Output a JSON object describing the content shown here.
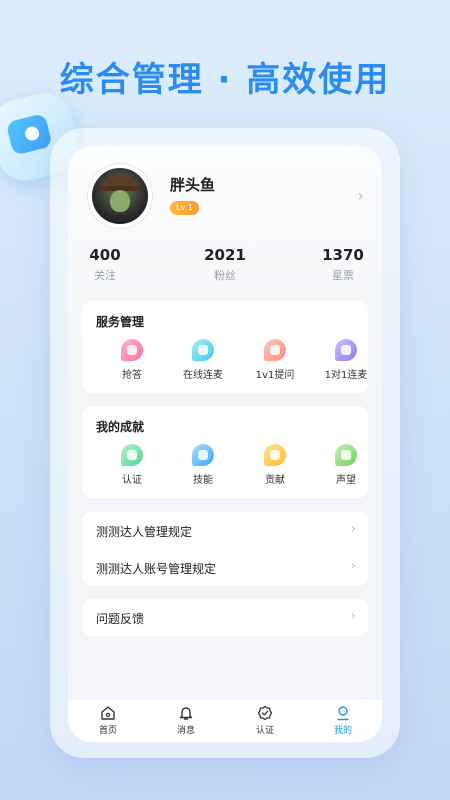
{
  "headline": "综合管理 · 高效使用",
  "profile": {
    "name": "胖头鱼",
    "level": "Lv 1",
    "arrow": "›"
  },
  "stats": [
    {
      "value": "400",
      "label": "关注"
    },
    {
      "value": "2021",
      "label": "粉丝"
    },
    {
      "value": "1370",
      "label": "星票"
    }
  ],
  "service": {
    "title": "服务管理",
    "items": [
      {
        "label": "抢答",
        "icon": "lightning-icon",
        "color": "#ff7aa8"
      },
      {
        "label": "在线连麦",
        "icon": "play-icon",
        "color": "#54d6e6"
      },
      {
        "label": "1v1提问",
        "icon": "chat-icon",
        "color": "#ff9a8a"
      },
      {
        "label": "1对1连麦",
        "icon": "phone-icon",
        "color": "#9a8cf5"
      }
    ]
  },
  "achievement": {
    "title": "我的成就",
    "items": [
      {
        "label": "认证",
        "icon": "check-icon",
        "color": "#5fdc9a"
      },
      {
        "label": "技能",
        "icon": "skill-icon",
        "color": "#4ab0f5"
      },
      {
        "label": "贡献",
        "icon": "contribute-icon",
        "color": "#ffc53a"
      },
      {
        "label": "声望",
        "icon": "reputation-icon",
        "color": "#7ad56a"
      }
    ]
  },
  "rules": [
    {
      "label": "测测达人管理规定"
    },
    {
      "label": "测测达人账号管理规定"
    }
  ],
  "feedback": {
    "label": "问题反馈"
  },
  "tabs": [
    {
      "label": "首页",
      "icon": "home-icon"
    },
    {
      "label": "消息",
      "icon": "bell-icon"
    },
    {
      "label": "认证",
      "icon": "badge-check-icon"
    },
    {
      "label": "我的",
      "icon": "user-icon"
    }
  ],
  "colors": {
    "accent": "#1a9adb",
    "headline": "#2a8cf0",
    "level_badge": "#ffa435"
  }
}
